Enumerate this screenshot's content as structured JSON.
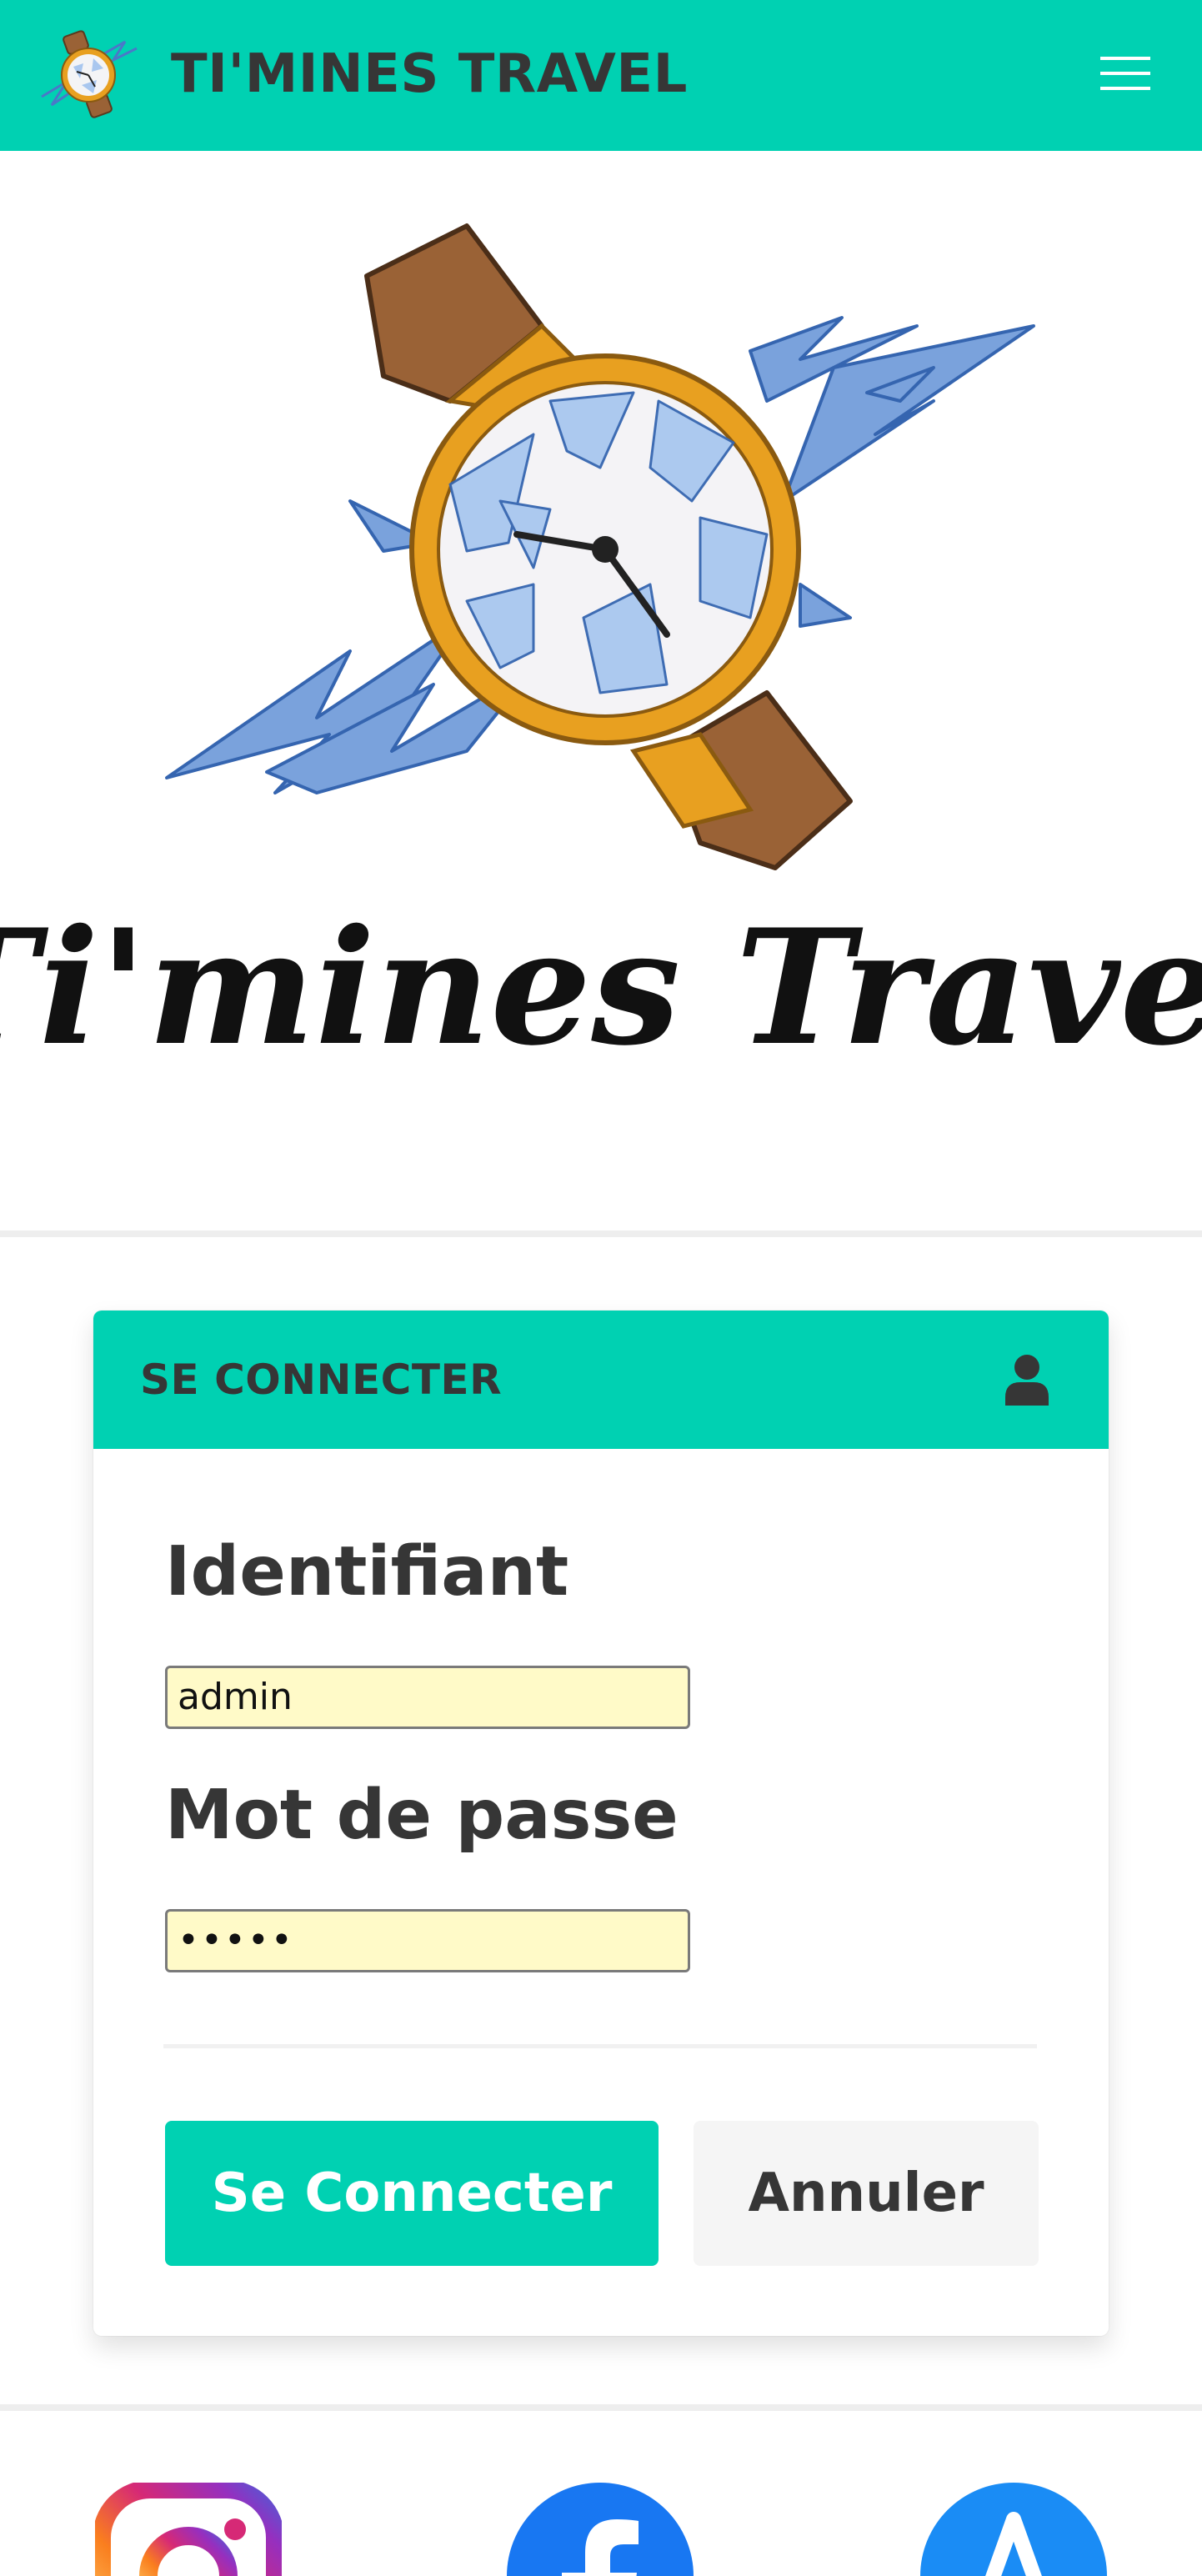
{
  "navbar": {
    "title": "TI'MINES TRAVEL",
    "logo_icon": "watch-logo-icon",
    "menu_icon": "hamburger-menu-icon",
    "background": "#00d1b2"
  },
  "hero": {
    "logo_text": "Ti'mines Travel",
    "logo_icon": "broken-watch-logo-icon"
  },
  "login": {
    "title": "SE CONNECTER",
    "header_icon": "user-icon",
    "username_label": "Identifiant",
    "username_value": "admin",
    "password_label": "Mot de passe",
    "password_value": "•••••",
    "submit_label": "Se Connecter",
    "cancel_label": "Annuler",
    "accent_color": "#00d1b2"
  },
  "social": {
    "items": [
      {
        "name": "instagram-icon"
      },
      {
        "name": "facebook-icon"
      },
      {
        "name": "app-store-icon"
      }
    ]
  }
}
